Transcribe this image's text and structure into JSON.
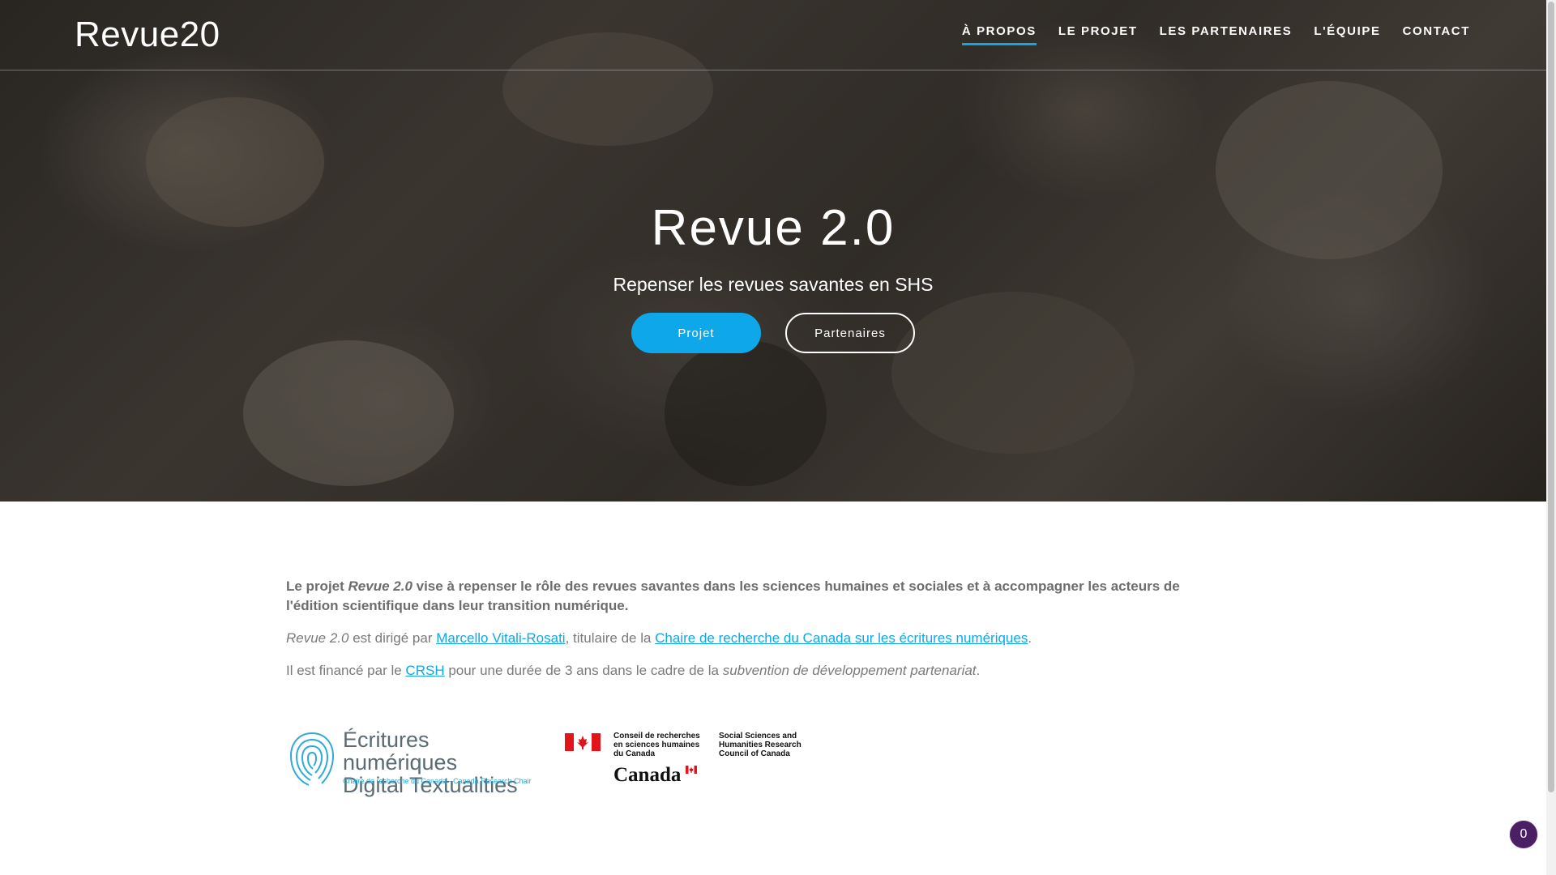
{
  "navbar": {
    "logo": "Revue20",
    "items": [
      {
        "label": "À PROPOS",
        "active": true
      },
      {
        "label": "LE PROJET",
        "active": false
      },
      {
        "label": "LES PARTENAIRES",
        "active": false
      },
      {
        "label": "L'ÉQUIPE",
        "active": false
      },
      {
        "label": "CONTACT",
        "active": false
      }
    ]
  },
  "hero": {
    "title": "Revue 2.0",
    "subtitle": "Repenser les revues savantes en SHS",
    "buttons": {
      "primary": "Projet",
      "secondary": "Partenaires"
    }
  },
  "content": {
    "p1": {
      "prefix": "Le projet ",
      "em": "Revue 2.0",
      "rest": " vise à repenser le rôle des revues savantes dans les sciences humaines et sociales et à accompagner les acteurs de l'édition scientifique dans leur transition numérique."
    },
    "p2": {
      "em": "Revue 2.0",
      "text1": " est dirigé par ",
      "link1": "Marcello Vitali-Rosati",
      "text2": ", titulaire de la ",
      "link2": "Chaire de recherche du Canada sur les écritures numériques",
      "text3": "."
    },
    "p3": {
      "text1": "Il est financé par le ",
      "link": "CRSH",
      "text2": " pour une durée de 3 ans dans le cadre de la ",
      "em": "subvention de développement partenariat",
      "text3": "."
    }
  },
  "logos": {
    "ecritures": {
      "line1": "Écritures numériques",
      "line2": "Digital Textualities",
      "sub": "Chaire de recherche du Canada - Canada Research Chair"
    },
    "crsh": {
      "fr1": "Conseil de recherches",
      "fr2": "en sciences humaines",
      "fr3": "du Canada",
      "en1": "Social Sciences and",
      "en2": "Humanities Research",
      "en3": "Council of Canada",
      "wordmark": "Canada"
    }
  },
  "badge": {
    "count": "0"
  },
  "colors": {
    "accent": "#0ea8ea",
    "badge": "#4b1f63",
    "text": "#7a7a7a"
  }
}
